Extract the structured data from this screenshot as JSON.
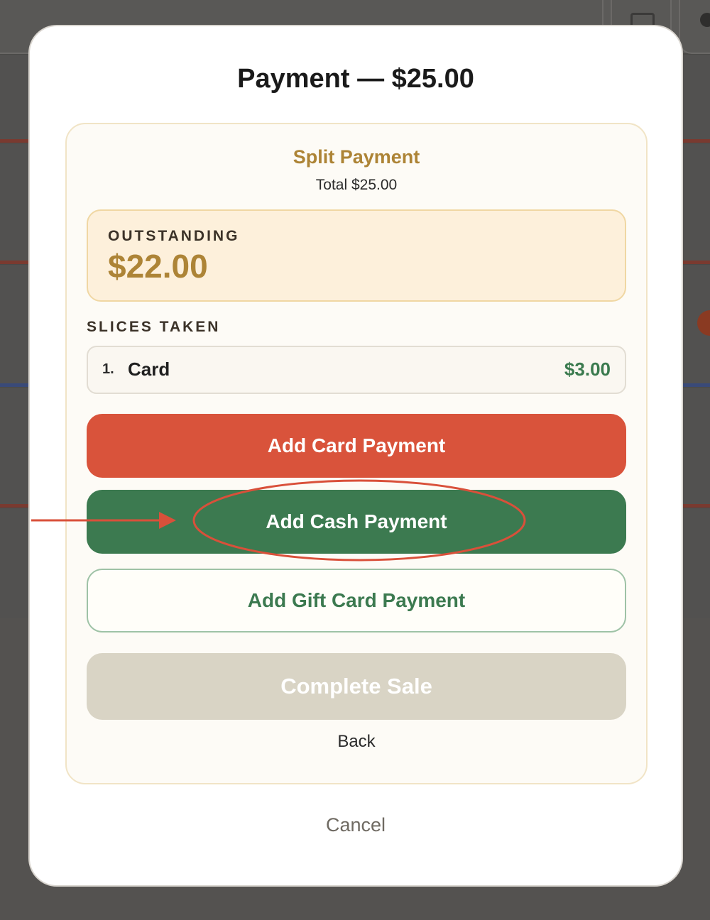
{
  "modal": {
    "title": "Payment — $25.00",
    "cancel_label": "Cancel"
  },
  "split": {
    "title": "Split Payment",
    "total_text": "Total $25.00",
    "outstanding_label": "OUTSTANDING",
    "outstanding_amount": "$22.00",
    "slices_label": "SLICES TAKEN",
    "slices": [
      {
        "number": "1.",
        "method": "Card",
        "amount": "$3.00"
      }
    ],
    "add_card_label": "Add Card Payment",
    "add_cash_label": "Add Cash Payment",
    "add_gift_label": "Add Gift Card Payment",
    "complete_label": "Complete Sale",
    "back_label": "Back"
  },
  "colors": {
    "accent_gold": "#ad8436",
    "card_red": "#d9533b",
    "cash_green": "#3c7a50",
    "annotation_red": "#d9503a"
  },
  "annotation": {
    "highlighted": "add-cash-payment-button",
    "shapes": [
      "arrow",
      "ellipse"
    ]
  }
}
